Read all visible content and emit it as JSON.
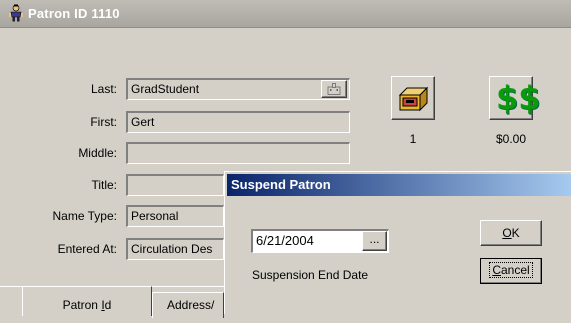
{
  "window": {
    "title": "Patron ID 1110"
  },
  "form": {
    "last_label": "Last:",
    "last_value": "GradStudent",
    "first_label": "First:",
    "first_value": "Gert",
    "middle_label": "Middle:",
    "middle_value": "",
    "title_label": "Title:",
    "title_value": "",
    "name_type_label": "Name Type:",
    "name_type_value": "Personal",
    "entered_at_label": "Entered At:",
    "entered_at_value": "Circulation Des"
  },
  "stats": {
    "items_count": "1",
    "fines_amount": "$0.00"
  },
  "tabs": {
    "patron_id_prefix": "Patron ",
    "patron_id_mnemonic": "I",
    "patron_id_suffix": "d",
    "address": "Address/"
  },
  "dialog": {
    "title": "Suspend Patron",
    "date_value": "6/21/2004",
    "browse_label": "...",
    "date_caption": "Suspension End Date",
    "ok_mnemonic": "O",
    "ok_rest": "K",
    "cancel_mnemonic": "C",
    "cancel_rest": "ancel"
  }
}
